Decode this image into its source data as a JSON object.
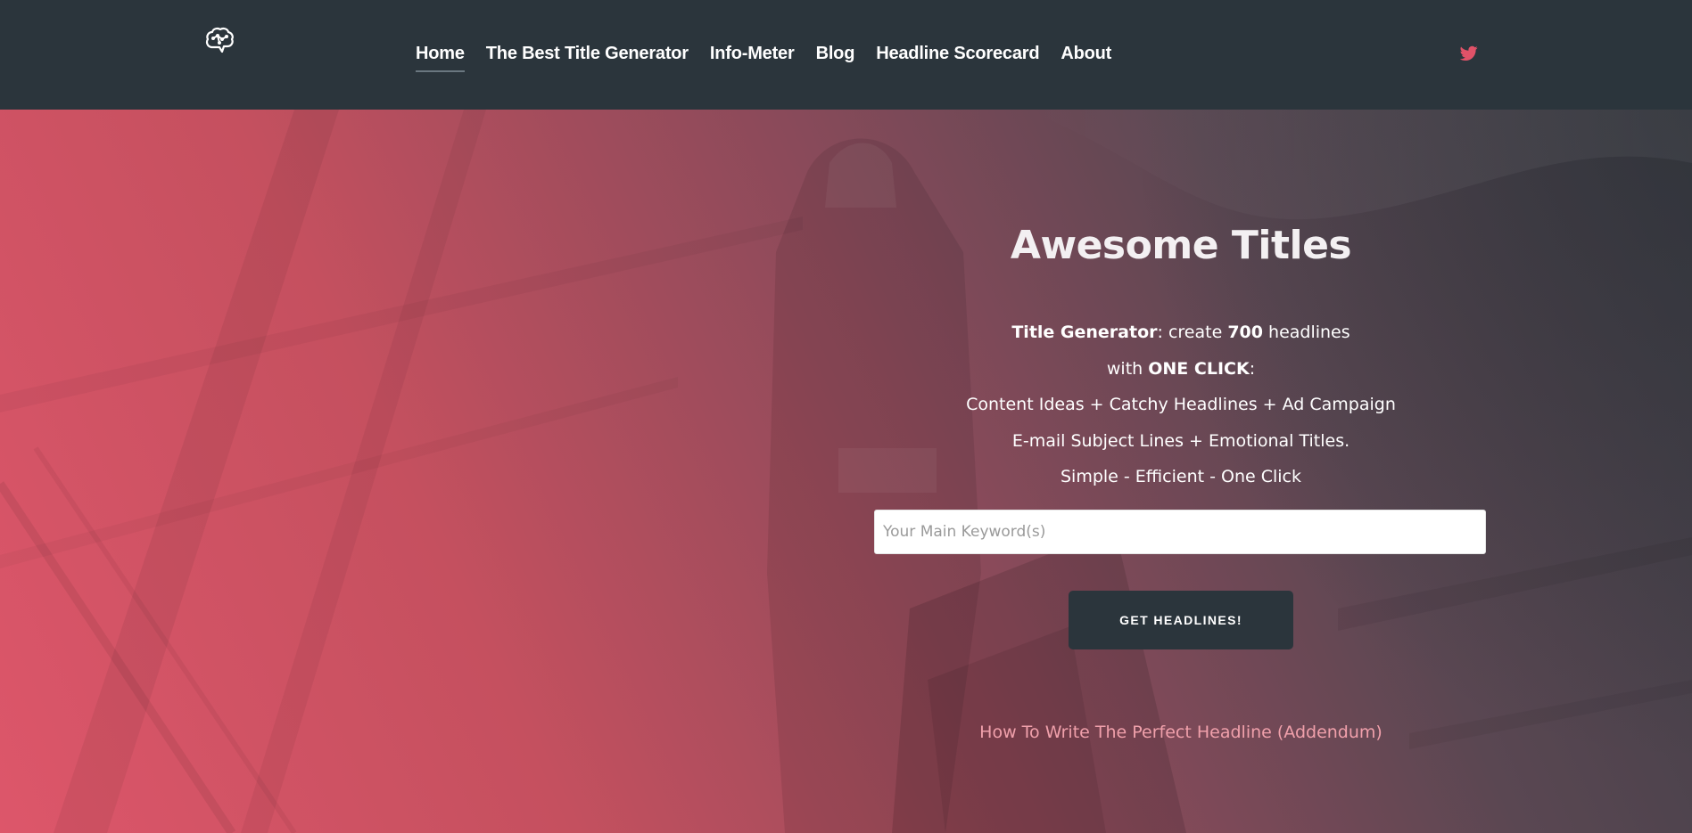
{
  "header": {
    "logo_icon": "brain-icon",
    "nav": [
      {
        "label": "Home",
        "active": true
      },
      {
        "label": "The Best Title Generator",
        "active": false
      },
      {
        "label": "Info-Meter",
        "active": false
      },
      {
        "label": "Blog",
        "active": false
      },
      {
        "label": "Headline Scorecard",
        "active": false
      },
      {
        "label": "About",
        "active": false
      }
    ],
    "twitter_icon": "twitter-icon",
    "colors": {
      "background": "#2b353c",
      "twitter": "#e05268"
    }
  },
  "hero": {
    "title": "Awesome Titles",
    "line1": {
      "bold1": "Title Generator",
      "text1": ": create ",
      "bold2": "700",
      "text2": " headlines"
    },
    "line2": {
      "text1": "with ",
      "bold1": "ONE CLICK",
      "text2": ":"
    },
    "line3": "Content Ideas + Catchy Headlines + Ad Campaign",
    "line4": "E-mail Subject Lines + Emotional Titles.",
    "line5": "Simple - Efficient - One Click",
    "search": {
      "placeholder": "Your Main Keyword(s)",
      "value": ""
    },
    "button_label": "GET HEADLINES!",
    "addendum_link": "How To Write The Perfect Headline (Addendum)",
    "colors": {
      "gradient_start": "#dd566a",
      "gradient_end": "#3a3d45",
      "link": "#f0a0ab"
    }
  }
}
